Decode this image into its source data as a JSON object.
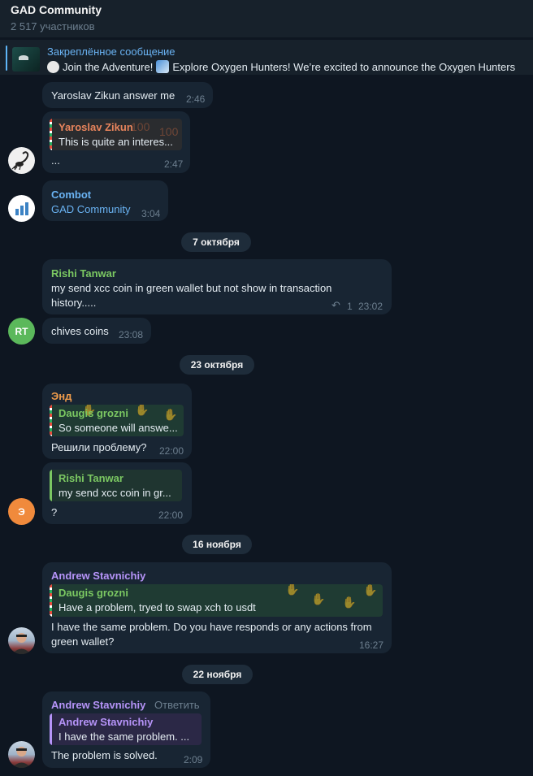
{
  "header": {
    "title": "GAD Community",
    "subtitle": "2 517 участников"
  },
  "pinned": {
    "label": "Закреплённое сообщение",
    "text_part1": "Join the Adventure!",
    "text_part2": "Explore Oxygen Hunters!  We’re excited to announce the Oxygen Hunters",
    "icon_1": "white-circle-emoji",
    "icon_2": "image-emoji"
  },
  "colors": {
    "background": "#0e1621",
    "bubble": "#182533",
    "accent_blue": "#6ab3f3",
    "orange_name": "#e8845c",
    "green_name": "#7bc862",
    "purple_name": "#b694f9",
    "amber_name": "#ee9b4b"
  },
  "messages": {
    "m1": {
      "text": "Yaroslav Zikun answer me",
      "time": "2:46"
    },
    "m2": {
      "reply_name": "Yaroslav Zikun",
      "reply_text": "This is quite an interes...",
      "text": "...",
      "time": "2:47"
    },
    "m3": {
      "sender": "Combot",
      "text": "GAD Community",
      "time": "3:04"
    },
    "m4": {
      "sender": "Rishi Tanwar",
      "line1": "my send xcc coin in green wallet but not show in transaction",
      "line2": "history.....",
      "reply_count": "1",
      "time": "23:02",
      "avatar": "RT"
    },
    "m5": {
      "text": "chives coins",
      "time": "23:08"
    },
    "m6": {
      "sender": "Энд",
      "reply_name": "Daugis grozni",
      "reply_text": "So someone will answe...",
      "text": "Решили проблему?",
      "time": "22:00"
    },
    "m7": {
      "reply_name": "Rishi Tanwar",
      "reply_text": "my send xcc coin in gr...",
      "text": "?",
      "time": "22:00",
      "avatar": "Э"
    },
    "m8": {
      "sender": "Andrew Stavnichiy",
      "reply_name": "Daugis grozni",
      "reply_text": "Have a problem, tryed to swap xch to usdt",
      "line1": "I have the same problem. Do you have responds or any actions from",
      "line2": "green wallet?",
      "time": "16:27"
    },
    "m9": {
      "sender": "Andrew Stavnichiy",
      "reply_action": "Ответить",
      "reply_name": "Andrew Stavnichiy",
      "reply_text": "I have the same problem. ...",
      "text": "The problem is solved.",
      "time": "2:09"
    }
  },
  "dates": {
    "d1": "7 октября",
    "d2": "23 октября",
    "d3": "16 ноября",
    "d4": "22 ноября"
  }
}
